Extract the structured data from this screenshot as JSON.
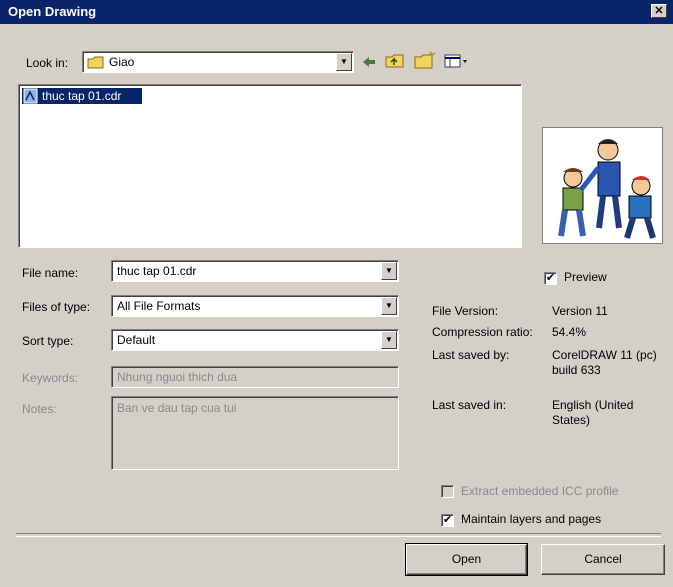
{
  "window": {
    "title": "Open Drawing",
    "close_glyph": "✕"
  },
  "look_in": {
    "label": "Look in:",
    "value": "Giao",
    "toolbar": [
      "back-arrow-icon",
      "up-folder-icon",
      "new-folder-icon",
      "view-menu-icon"
    ]
  },
  "file_list": [
    {
      "name": "thuc tap 01.cdr",
      "selected": true
    }
  ],
  "form": {
    "file_name": {
      "label": "File name:",
      "value": "thuc tap 01.cdr"
    },
    "files_of_type": {
      "label": "Files of type:",
      "value": "All File Formats"
    },
    "sort_type": {
      "label": "Sort type:",
      "value": "Default"
    },
    "keywords": {
      "label": "Keywords:",
      "value": "Nhung nguoi thich dua"
    },
    "notes": {
      "label": "Notes:",
      "value": "Ban ve dau tap cua tui"
    }
  },
  "preview": {
    "label": "Preview",
    "checked": true
  },
  "info": [
    {
      "label": "File Version:",
      "value": "Version 11"
    },
    {
      "label": "Compression ratio:",
      "value": "54.4%"
    },
    {
      "label": "Last saved by:",
      "value": "CorelDRAW 11 (pc) build 633"
    },
    {
      "label": "Last saved in:",
      "value": "English (United States)"
    }
  ],
  "options": {
    "extract_icc": {
      "label": "Extract embedded ICC profile",
      "checked": false,
      "enabled": false
    },
    "maintain_layers": {
      "label": "Maintain layers and pages",
      "checked": true,
      "enabled": true
    }
  },
  "buttons": {
    "open": "Open",
    "cancel": "Cancel"
  },
  "check_glyph": "✔",
  "dropdown_glyph": "▼"
}
